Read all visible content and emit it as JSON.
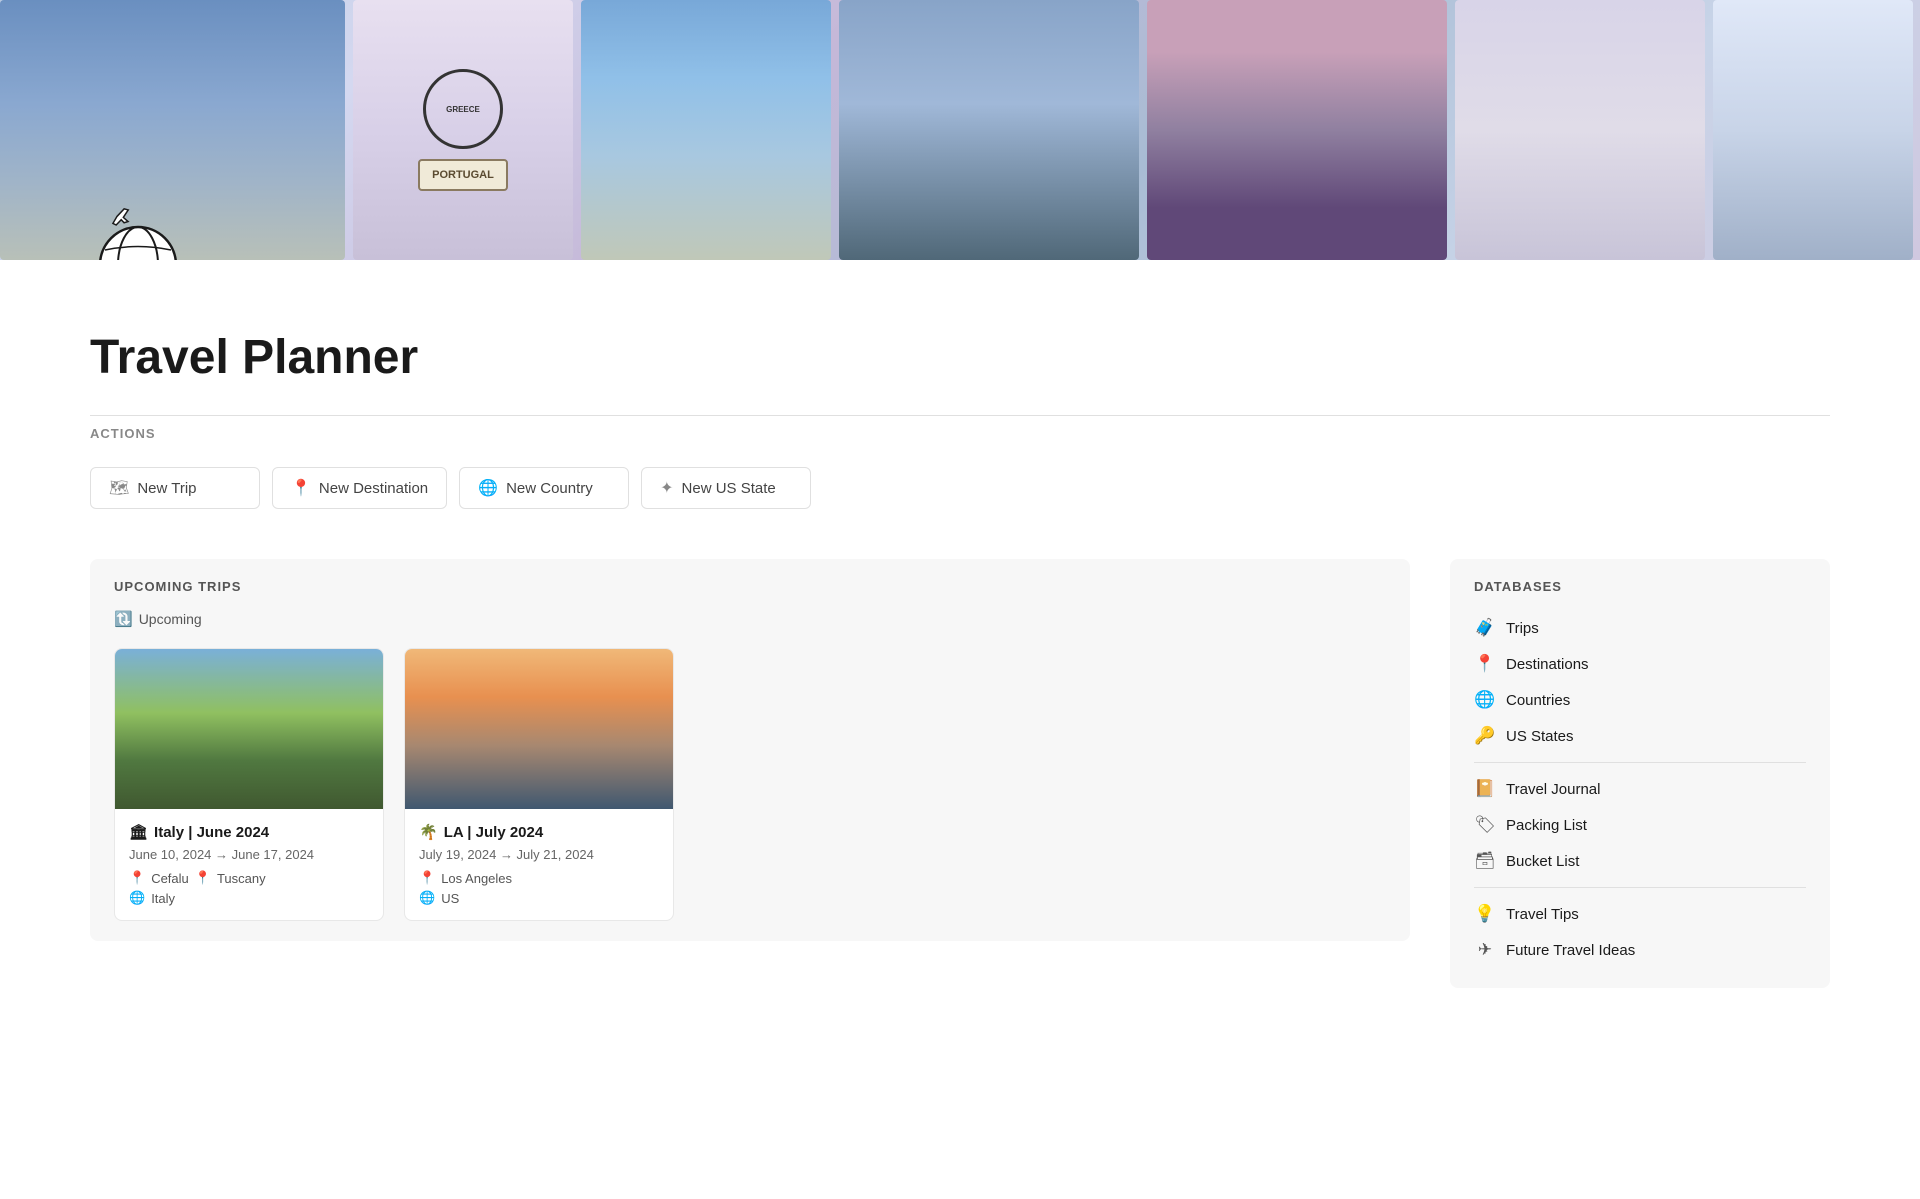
{
  "header": {
    "banner_alt": "Travel collage banner",
    "portugal_label": "PORTUGAL",
    "greece_label": "GREECE"
  },
  "page": {
    "title": "Travel Planner",
    "icon": "🌍"
  },
  "actions": {
    "label": "ACTIONS",
    "buttons": [
      {
        "id": "new-trip",
        "icon": "🗺",
        "label": "New Trip"
      },
      {
        "id": "new-destination",
        "icon": "📍",
        "label": "New Destination"
      },
      {
        "id": "new-country",
        "icon": "🌐",
        "label": "New Country"
      },
      {
        "id": "new-us-state",
        "icon": "✦",
        "label": "New US State"
      }
    ]
  },
  "upcoming_trips": {
    "section_title": "UPCOMING TRIPS",
    "filter_label": "Upcoming",
    "trips": [
      {
        "id": "italy",
        "emoji": "🏛",
        "title": "Italy | June 2024",
        "dates": "June 10, 2024 → June 17, 2024",
        "destinations": [
          "Cefalu",
          "Tuscany"
        ],
        "country": "Italy"
      },
      {
        "id": "la",
        "emoji": "🌴",
        "title": "LA | July 2024",
        "dates": "July 19, 2024 → July 21, 2024",
        "destinations": [
          "Los Angeles"
        ],
        "country": "US"
      }
    ]
  },
  "databases": {
    "section_title": "DATABASES",
    "groups": [
      {
        "items": [
          {
            "id": "trips",
            "icon": "🧳",
            "label": "Trips"
          },
          {
            "id": "destinations",
            "icon": "📍",
            "label": "Destinations"
          },
          {
            "id": "countries",
            "icon": "🌐",
            "label": "Countries"
          },
          {
            "id": "us-states",
            "icon": "🔑",
            "label": "US States"
          }
        ]
      },
      {
        "items": [
          {
            "id": "travel-journal",
            "icon": "📔",
            "label": "Travel Journal"
          },
          {
            "id": "packing-list",
            "icon": "🏷",
            "label": "Packing List"
          },
          {
            "id": "bucket-list",
            "icon": "🗃",
            "label": "Bucket List"
          }
        ]
      },
      {
        "items": [
          {
            "id": "travel-tips",
            "icon": "💡",
            "label": "Travel Tips"
          },
          {
            "id": "future-travel-ideas",
            "icon": "✈",
            "label": "Future Travel Ideas"
          }
        ]
      }
    ]
  }
}
